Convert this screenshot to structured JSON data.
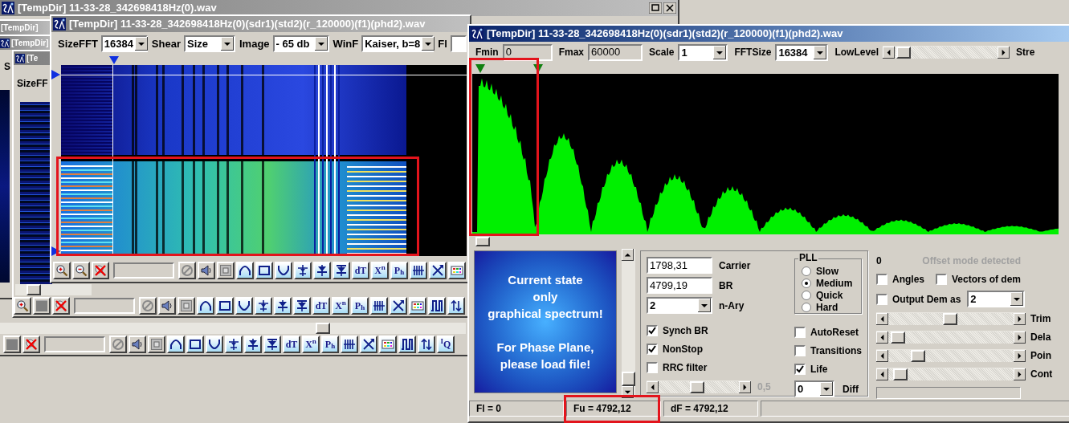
{
  "background_windows": [
    {
      "title": "[TempDir] 11-33-28_342698418Hz(0).wav",
      "active": false,
      "toolbar": [
        {
          "kind": "blank"
        },
        {
          "kind": "cancel"
        },
        {
          "kind": "field"
        },
        {
          "kind": "nosign"
        },
        {
          "kind": "speaker"
        },
        {
          "kind": "frame"
        },
        {
          "kind": "arch"
        },
        {
          "kind": "rect"
        },
        {
          "kind": "valley"
        },
        {
          "kind": "pin"
        },
        {
          "kind": "drop"
        },
        {
          "kind": "dropbar"
        },
        {
          "kind": "text",
          "label": "dT"
        },
        {
          "kind": "text",
          "label": "X$^{n}$"
        },
        {
          "kind": "text",
          "label": "P$_{h}$"
        },
        {
          "kind": "bars"
        },
        {
          "kind": "cross"
        },
        {
          "kind": "palette"
        },
        {
          "kind": "pulse"
        },
        {
          "kind": "updown"
        },
        {
          "kind": "text",
          "label": "$^{I}$Q"
        }
      ]
    },
    {
      "title": "[TempDir]",
      "active": false
    },
    {
      "title": "[TempDir]",
      "active": false,
      "label": "S"
    },
    {
      "title": "[Te",
      "active": false,
      "label": "SizeFF",
      "toolbar": [
        {
          "kind": "zoomin"
        },
        {
          "kind": "blank"
        },
        {
          "kind": "cancel"
        },
        {
          "kind": "field"
        },
        {
          "kind": "nosign"
        },
        {
          "kind": "speaker"
        },
        {
          "kind": "frame"
        },
        {
          "kind": "arch"
        },
        {
          "kind": "rect"
        },
        {
          "kind": "valley"
        },
        {
          "kind": "pin"
        },
        {
          "kind": "drop"
        },
        {
          "kind": "dropbar"
        },
        {
          "kind": "text",
          "label": "dT"
        },
        {
          "kind": "text",
          "label": "X$^{n}$"
        },
        {
          "kind": "text",
          "label": "P$_{h}$"
        },
        {
          "kind": "bars"
        },
        {
          "kind": "cross"
        },
        {
          "kind": "palette"
        },
        {
          "kind": "pulse"
        },
        {
          "kind": "updown"
        }
      ]
    }
  ],
  "spectrogram_window": {
    "title": "[TempDir] 11-33-28_342698418Hz(0)(sdr1)(std2)(r_120000)(f1)(phd2).wav",
    "active": false,
    "controls": [
      {
        "label": "SizeFFT",
        "value": "16384"
      },
      {
        "label": "Shear",
        "value": "Size"
      },
      {
        "label": "Image",
        "value": "- 65 db"
      },
      {
        "label": "WinF",
        "value": "Kaiser, b=8"
      },
      {
        "label": "Fl"
      }
    ],
    "toolbar": [
      {
        "kind": "zoomin"
      },
      {
        "kind": "zoomout"
      },
      {
        "kind": "cancel"
      },
      {
        "kind": "field"
      },
      {
        "kind": "nosign"
      },
      {
        "kind": "speaker"
      },
      {
        "kind": "frame"
      },
      {
        "kind": "arch"
      },
      {
        "kind": "rect"
      },
      {
        "kind": "valley"
      },
      {
        "kind": "pin"
      },
      {
        "kind": "drop"
      },
      {
        "kind": "dropbar"
      },
      {
        "kind": "text",
        "label": "dT"
      },
      {
        "kind": "text",
        "label": "X$^{n}$"
      },
      {
        "kind": "text",
        "label": "P$_{h}$"
      },
      {
        "kind": "bars"
      },
      {
        "kind": "cross"
      },
      {
        "kind": "palette"
      }
    ]
  },
  "spectrum_window": {
    "title": "[TempDir] 11-33-28_342698418Hz(0)(sdr1)(std2)(r_120000)(f1)(phd2).wav",
    "active": true,
    "controls": [
      {
        "kind": "readonly",
        "label": "Fmin",
        "value": "0"
      },
      {
        "kind": "readonly",
        "label": "Fmax",
        "value": "60000"
      },
      {
        "kind": "select",
        "label": "Scale",
        "value": "1"
      },
      {
        "kind": "select",
        "label": "FFTSize",
        "value": "16384"
      },
      {
        "kind": "slider",
        "label": "LowLevel",
        "level": 0.02
      },
      {
        "kind": "label",
        "label": "Stre"
      }
    ],
    "message": "Current state\nonly\ngraphical spectrum!\n\nFor Phase Plane,\nplease load file!",
    "fields": [
      {
        "kind": "input",
        "value": "1798,31",
        "label": "Carrier"
      },
      {
        "kind": "input",
        "value": "4799,19",
        "label": "BR"
      },
      {
        "kind": "select",
        "value": "2",
        "label": "n-Ary"
      }
    ],
    "pll": {
      "title": "PLL",
      "options": [
        {
          "label": "Slow",
          "selected": false
        },
        {
          "label": "Medium",
          "selected": true
        },
        {
          "label": "Quick",
          "selected": false
        },
        {
          "label": "Hard",
          "selected": false
        }
      ]
    },
    "checks_left": [
      {
        "label": "Synch BR",
        "checked": true
      },
      {
        "label": "NonStop",
        "checked": true
      },
      {
        "label": "RRC filter",
        "checked": false
      }
    ],
    "checks_right": [
      {
        "label": "AutoReset",
        "checked": false
      },
      {
        "label": "Transitions",
        "checked": false
      },
      {
        "label": "Life",
        "checked": true
      }
    ],
    "rolloff": {
      "level": 0.48,
      "reading": "0,5"
    },
    "diff": {
      "value": "0",
      "label": "Diff"
    },
    "count": "0",
    "notice": "Offset mode detected",
    "options": [
      {
        "label": "Angles",
        "checked": false
      },
      {
        "label": "Vectors of dem",
        "checked": false
      }
    ],
    "output": {
      "label": "Output Dem as",
      "checked": false,
      "value": "2"
    },
    "sliders": [
      {
        "label": "Trim",
        "level": 0.49
      },
      {
        "label": "Dela",
        "level": 0.02
      },
      {
        "label": "Poin",
        "level": 0.2
      },
      {
        "label": "Cont",
        "level": 0.04
      }
    ],
    "progress": {
      "level": 0
    },
    "status_bar": [
      "Fl = 0",
      "Fu = 4792,12",
      "dF = 4792,12"
    ]
  }
}
